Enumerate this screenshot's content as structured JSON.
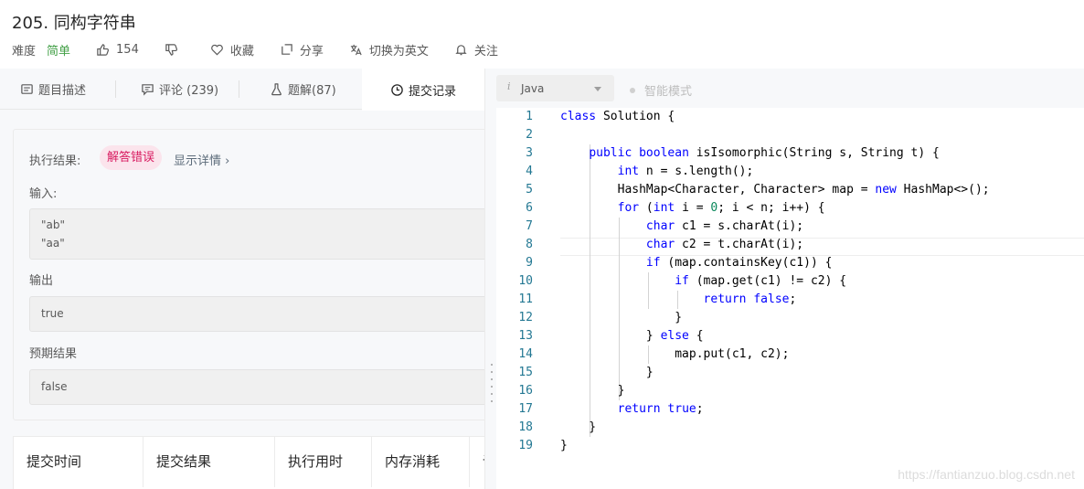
{
  "problem": {
    "title": "205. 同构字符串",
    "difficulty_label": "难度",
    "difficulty": "简单",
    "likes": "154",
    "favorite": "收藏",
    "share": "分享",
    "switch_lang": "切换为英文",
    "follow": "关注"
  },
  "tabs": [
    {
      "label": "题目描述",
      "icon": "description-icon"
    },
    {
      "label": "评论 (239)",
      "icon": "comment-icon"
    },
    {
      "label": "题解(87)",
      "icon": "flask-icon"
    },
    {
      "label": "提交记录",
      "icon": "clock-icon",
      "active": true
    }
  ],
  "result": {
    "label": "执行结果:",
    "status": "解答错误",
    "detail_link": "显示详情 ›",
    "input_label": "输入:",
    "input_lines": [
      "\"ab\"",
      "\"aa\""
    ],
    "output_label": "输出",
    "output": "true",
    "expected_label": "预期结果",
    "expected": "false"
  },
  "table": {
    "headers": [
      "提交时间",
      "提交结果",
      "执行用时",
      "内存消耗",
      "语"
    ]
  },
  "editor": {
    "language": "Java",
    "smart_mode": "智能模式",
    "line_numbers": [
      "1",
      "2",
      "3",
      "4",
      "5",
      "6",
      "7",
      "8",
      "9",
      "10",
      "11",
      "12",
      "13",
      "14",
      "15",
      "16",
      "17",
      "18",
      "19"
    ],
    "watermark": "https://fantianzuo.blog.csdn.net"
  },
  "colors": {
    "accent_green": "#43a047",
    "error_red": "#d81b60",
    "keyword_blue": "#0000ff",
    "line_number": "#237893"
  }
}
